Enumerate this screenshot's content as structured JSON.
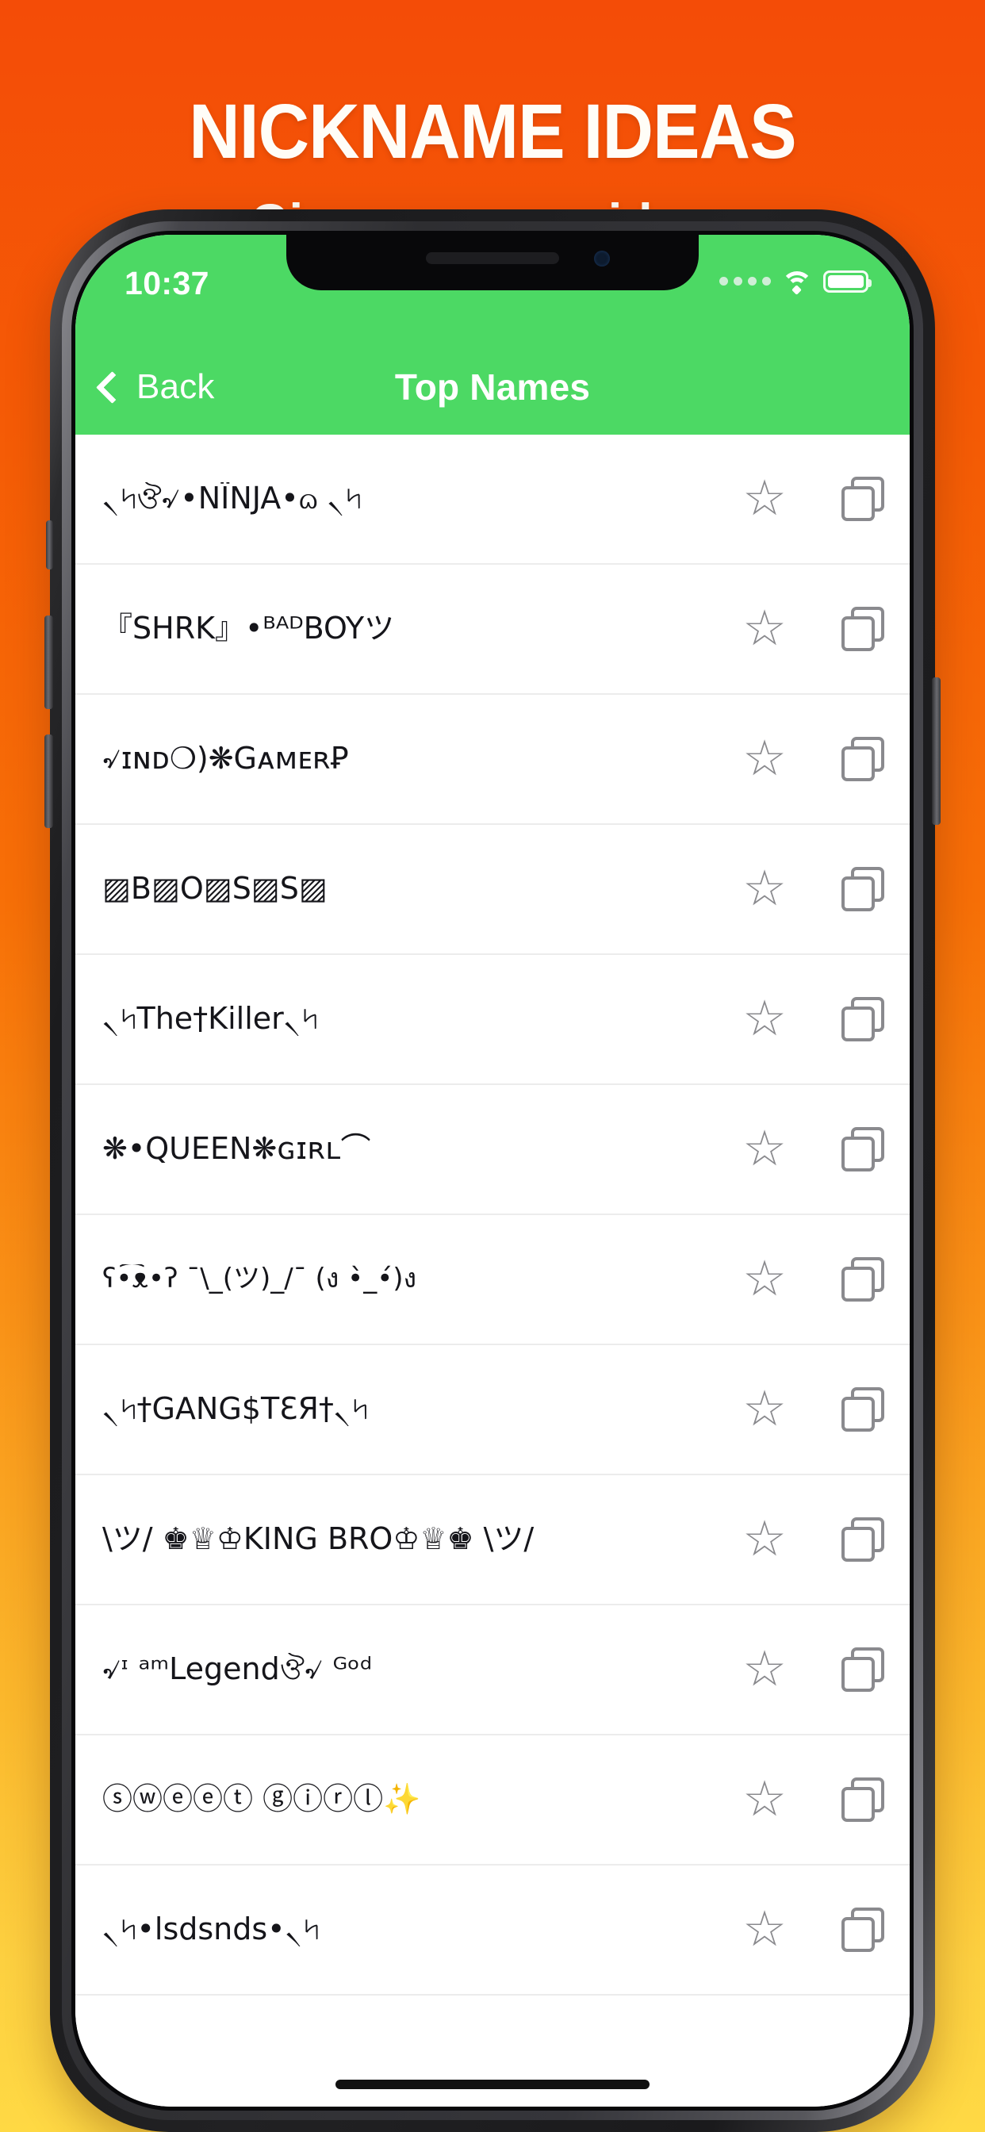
{
  "promo": {
    "title": "NICKNAME IDEAS",
    "subtitle": "Give you more ideas",
    "background_top_color": "#f44c07",
    "background_bottom_color": "#ffd944"
  },
  "phone": {
    "accent_color": "#4cd964",
    "statusbar": {
      "time": "10:37",
      "signal_icon": "signal-dots-icon",
      "wifi_icon": "wifi-icon",
      "battery_icon": "battery-full-icon"
    },
    "navbar": {
      "back_label": "Back",
      "back_icon": "chevron-left-icon",
      "title": "Top Names"
    },
    "list": {
      "favorite_icon": "star-outline-icon",
      "copy_icon": "copy-icon",
      "items": [
        {
          "name": "৲৸ঔ৵•NÏNJA•ᦒ ৲৸"
        },
        {
          "name": "『SHRK』•ᴮᴬᴰBOYツ"
        },
        {
          "name": "৵ɪɴᴅ❍)❋GᴀᴍᴇʀꝐ"
        },
        {
          "name": "▨B▨O▨S▨S▨"
        },
        {
          "name": "৲৸The†Killer৲৸"
        },
        {
          "name": "❋•QUEEN❋ɢɪʀʟ⌒"
        },
        {
          "name": "ʕ•͡ᴥ•ʔ ¯\\_(ツ)_/¯ (ง •̀_•́)ง"
        },
        {
          "name": "৲৸†GANG$TƐЯ†৲৸"
        },
        {
          "name": "\\ツ/ ♚♕♔KING BRO♔♕♚ \\ツ/"
        },
        {
          "name": "৵ᶦ ᵃᵐLegendঔ৵ ᴳᵒᵈ"
        },
        {
          "name": "ⓢⓦⓔⓔⓣ ⓖⓘⓡⓛ✨"
        },
        {
          "name": "৲৸•lsdsnds•৲৸"
        }
      ]
    }
  }
}
